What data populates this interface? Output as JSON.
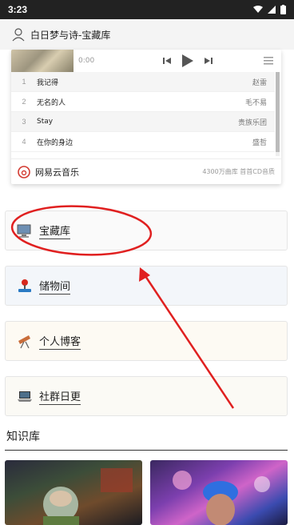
{
  "status_bar": {
    "time": "3:23"
  },
  "topbar": {
    "title": "白日梦与诗-宝藏库"
  },
  "player": {
    "time": "0:00",
    "tracks": [
      {
        "num": "1",
        "song": "我记得",
        "artist": "赵雷"
      },
      {
        "num": "2",
        "song": "无名的人",
        "artist": "毛不易"
      },
      {
        "num": "3",
        "song": "Stay",
        "artist": "贵族乐团"
      },
      {
        "num": "4",
        "song": "在你的身边",
        "artist": "盛哲"
      }
    ],
    "brand": "网易云音乐",
    "tagline": "4300万曲库 首首CD音质"
  },
  "nav": {
    "treasure": "宝藏库",
    "storage": "储物间",
    "blog": "个人博客",
    "daily": "社群日更"
  },
  "section": {
    "title": "知识库"
  },
  "colors": {
    "annotation_red": "#e02020",
    "netease_red": "#d33a31"
  }
}
